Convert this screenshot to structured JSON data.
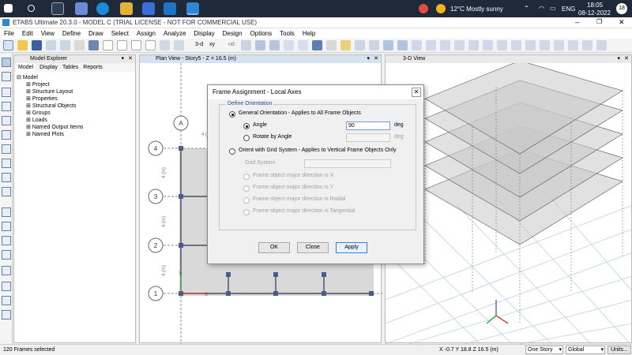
{
  "taskbar": {
    "weather": "12°C  Mostly sunny",
    "lang": "ENG",
    "time": "18:05",
    "date": "08-12-2022",
    "notif_count": "18"
  },
  "app": {
    "title": "ETABS Ultimate 20.3.0 - MODEL C  (TRIAL LICENSE - NOT FOR COMMERCIAL USE)"
  },
  "menu": [
    "File",
    "Edit",
    "View",
    "Define",
    "Draw",
    "Select",
    "Assign",
    "Analyze",
    "Display",
    "Design",
    "Options",
    "Tools",
    "Help"
  ],
  "toolbar": {
    "label_3d": "3-d",
    "label_xy": "xy",
    "label_nd": "nd"
  },
  "explorer": {
    "title": "Model Explorer",
    "tabs": [
      "Model",
      "Display",
      "Tables",
      "Reports"
    ],
    "root": "Model",
    "items": [
      "Project",
      "Structure Layout",
      "Properties",
      "Structural Objects",
      "Groups",
      "Loads",
      "Named Output Items",
      "Named Plots"
    ]
  },
  "plan": {
    "title": "Plan View - Story5 - Z = 16.5 (m)",
    "grid_col": "A",
    "grid_rows": [
      "4",
      "3",
      "2",
      "1"
    ],
    "dim_top": "4 (m)",
    "dim_side": [
      "4 (m)",
      "4 (m)",
      "4 (m)"
    ],
    "axis_x": "X",
    "axis_y": "Y"
  },
  "view3d": {
    "title": "3-D View"
  },
  "dialog": {
    "title": "Frame Assignment - Local Axes",
    "group_label": "Define Orientation",
    "opt_general": "General Orientation - Applies to All Frame Objects",
    "opt_angle": "Angle",
    "angle_value": "90",
    "unit_deg": "deg",
    "opt_rotate": "Rotate by Angle",
    "opt_grid": "Orient with Grid System - Applies to Vertical Frame Objects Only",
    "grid_system_label": "Grid System",
    "major_x": "Frame object major direction is X",
    "major_y": "Frame object major direction is Y",
    "major_radial": "Frame object major direction is Radial",
    "major_tangential": "Frame object major direction is Tangential",
    "ok": "OK",
    "close": "Close",
    "apply": "Apply"
  },
  "status": {
    "selection": "120 Frames selected",
    "coords": "X -0.7  Y 18.8  Z 16.5 (m)",
    "story": "One Story",
    "coord_sys": "Global",
    "units": "Units..."
  }
}
